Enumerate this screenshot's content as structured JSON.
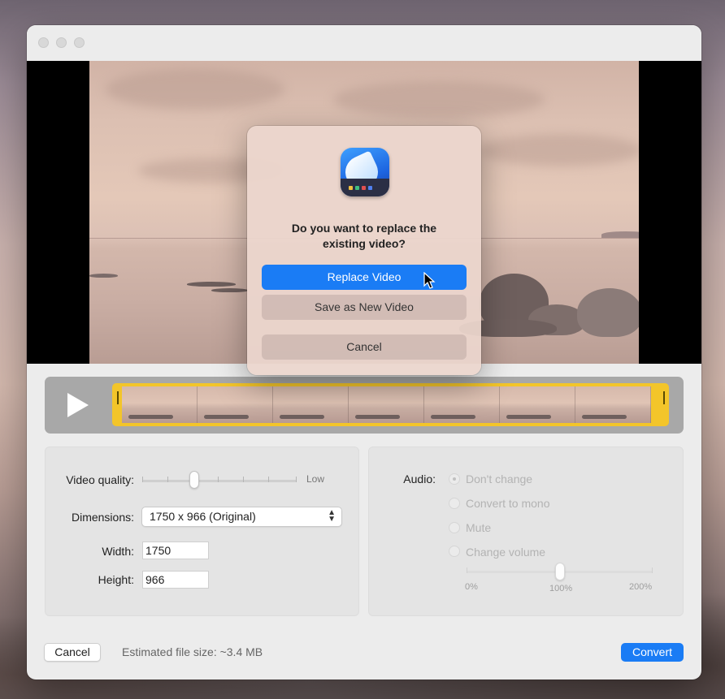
{
  "dialog": {
    "message": "Do you want to replace the\nexisting video?",
    "replace_label": "Replace Video",
    "save_new_label": "Save as New Video",
    "cancel_label": "Cancel"
  },
  "trim": {
    "play_icon": "play-icon",
    "thumbnail_count": 7
  },
  "video_settings": {
    "quality_label": "Video quality:",
    "quality_max_label": "Low",
    "dimensions_label": "Dimensions:",
    "dimensions_value": "1750 x 966  (Original)",
    "width_label": "Width:",
    "width_value": "1750",
    "height_label": "Height:",
    "height_value": "966"
  },
  "audio": {
    "label": "Audio:",
    "options": [
      "Don't change",
      "Convert to mono",
      "Mute",
      "Change volume"
    ],
    "selected": "Don't change",
    "volume_min": "0%",
    "volume_mid": "100%",
    "volume_max": "200%"
  },
  "footer": {
    "cancel_label": "Cancel",
    "estimate": "Estimated file size: ~3.4 MB",
    "convert_label": "Convert"
  },
  "colors": {
    "accent": "#1a7cf5",
    "trim_highlight": "#f3c52a"
  }
}
